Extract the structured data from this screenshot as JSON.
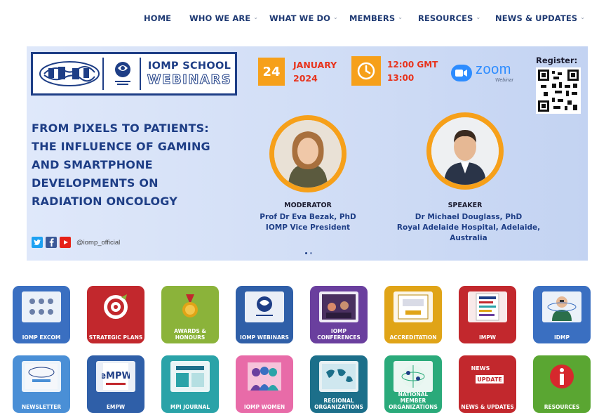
{
  "nav": {
    "items": [
      {
        "label": "HOME",
        "has_caret": false
      },
      {
        "label": "WHO WE ARE",
        "has_caret": true
      },
      {
        "label": "WHAT WE DO",
        "has_caret": true
      },
      {
        "label": "MEMBERS",
        "has_caret": true
      },
      {
        "label": "RESOURCES",
        "has_caret": true
      },
      {
        "label": "NEWS & UPDATES",
        "has_caret": true
      }
    ],
    "caret_icon": "chevron-down-icon"
  },
  "banner": {
    "logo_title": "IOMP SCHOOL",
    "logo_subtitle": "WEBINARS",
    "date_day": "24",
    "date_month": "JANUARY",
    "date_year": "2024",
    "time_start": "12:00 GMT",
    "time_end": "13:00",
    "platform": "zoom",
    "platform_sub": "Webinar",
    "register_label": "Register:",
    "headline": [
      "FROM PIXELS TO PATIENTS:",
      "THE INFLUENCE OF GAMING",
      "AND SMARTPHONE",
      "DEVELOPMENTS ON",
      "RADIATION ONCOLOGY"
    ],
    "moderator": {
      "role": "MODERATOR",
      "name": "Prof Dr Eva Bezak, PhD",
      "title": "IOMP Vice President"
    },
    "speaker": {
      "role": "SPEAKER",
      "name": "Dr Michael Douglass, PhD",
      "title_line1": "Royal Adelaide Hospital, Adelaide,",
      "title_line2": "Australia"
    },
    "social_handle": "@iomp_official",
    "colors": {
      "navy": "#1e3e86",
      "orange": "#f6a01a",
      "red": "#e8331c",
      "zoom_blue": "#2d8cff"
    }
  },
  "tiles": [
    {
      "label": "IOMP EXCOM",
      "color": "#3a6fc1",
      "icon": "team-photo-icon"
    },
    {
      "label": "STRATEGIC PLANS",
      "color": "#c2282d",
      "icon": "target-icon"
    },
    {
      "label": "AWARDS & HONOURS",
      "color": "#8bb33a",
      "icon": "award-medal-icon"
    },
    {
      "label": "IOMP WEBINARS",
      "color": "#2f5fa8",
      "icon": "webinar-logo-icon"
    },
    {
      "label": "IOMP CONFERENCES",
      "color": "#6a3f9e",
      "icon": "conference-icon"
    },
    {
      "label": "ACCREDITATION",
      "color": "#e0a417",
      "icon": "certificate-icon"
    },
    {
      "label": "IMPW",
      "color": "#c2282d",
      "icon": "poster-icon"
    },
    {
      "label": "IDMP",
      "color": "#3a6fc1",
      "icon": "scientist-icon"
    },
    {
      "label": "NEWSLETTER",
      "color": "#4a8fd6",
      "icon": "newsletter-icon"
    },
    {
      "label": "eMPW",
      "color": "#2f5fa8",
      "icon": "empw-icon"
    },
    {
      "label": "MPI JOURNAL",
      "color": "#2aa3a8",
      "icon": "journal-icon"
    },
    {
      "label": "IOMP WOMEN",
      "color": "#e86ba8",
      "icon": "women-icon"
    },
    {
      "label": "REGIONAL ORGANIZATIONS",
      "color": "#1c6f8a",
      "icon": "world-map-icon"
    },
    {
      "label": "NATIONAL MEMBER ORGANIZATIONS",
      "color": "#2aaa7a",
      "icon": "globe-icon"
    },
    {
      "label": "NEWS & UPDATES",
      "color": "#c2282d",
      "icon": "news-update-icon"
    },
    {
      "label": "RESOURCES",
      "color": "#5aa632",
      "icon": "info-icon"
    }
  ]
}
